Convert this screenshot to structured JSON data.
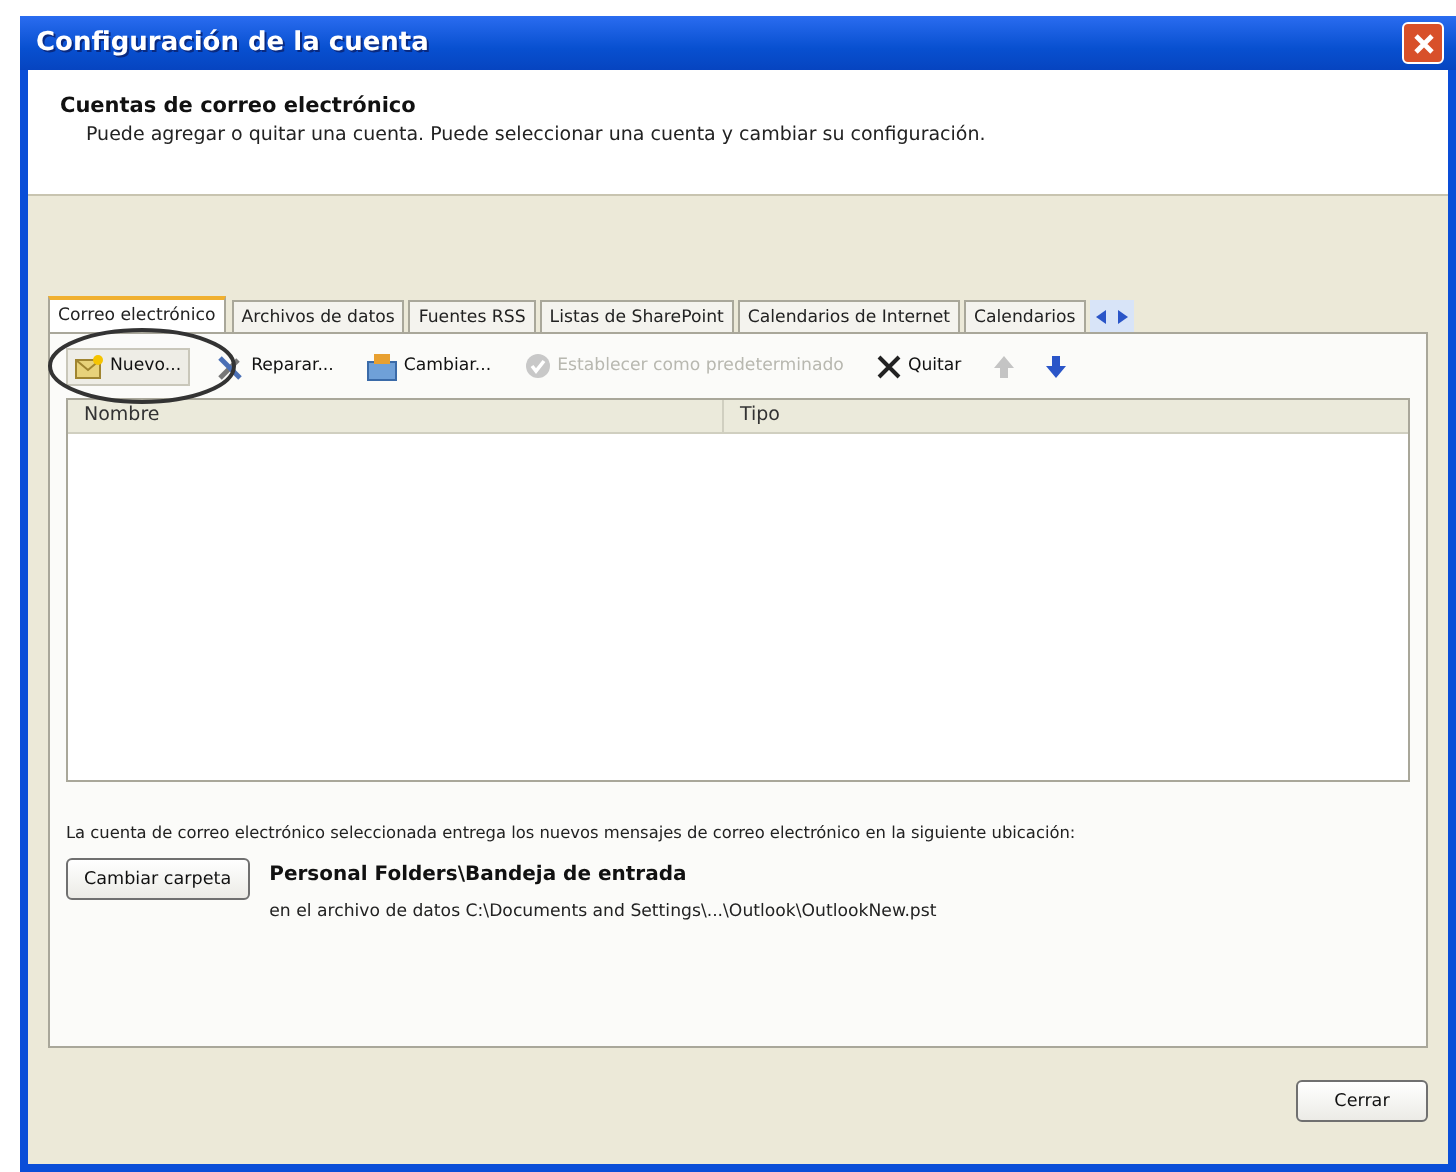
{
  "window": {
    "title": "Configuración de la cuenta"
  },
  "header": {
    "title": "Cuentas de correo electrónico",
    "subtitle": "Puede agregar o quitar una cuenta. Puede seleccionar una cuenta y cambiar su configuración."
  },
  "tabs": [
    {
      "label": "Correo electrónico",
      "selected": true
    },
    {
      "label": "Archivos de datos",
      "selected": false
    },
    {
      "label": "Fuentes RSS",
      "selected": false
    },
    {
      "label": "Listas de SharePoint",
      "selected": false
    },
    {
      "label": "Calendarios de Internet",
      "selected": false
    },
    {
      "label": "Calendarios",
      "selected": false
    }
  ],
  "toolbar": [
    {
      "kind": "new",
      "label": "Nuevo...",
      "disabled": false
    },
    {
      "kind": "repair",
      "label": "Reparar...",
      "disabled": false
    },
    {
      "kind": "change",
      "label": "Cambiar...",
      "disabled": false
    },
    {
      "kind": "default",
      "label": "Establecer como predeterminado",
      "disabled": true
    },
    {
      "kind": "remove",
      "label": "Quitar",
      "disabled": false
    },
    {
      "kind": "up",
      "disabled": true
    },
    {
      "kind": "down",
      "disabled": false
    }
  ],
  "table": {
    "columns": [
      "Nombre",
      "Tipo"
    ]
  },
  "delivery": {
    "text": "La cuenta de correo electrónico seleccionada entrega los nuevos mensajes de correo electrónico en la siguiente ubicación:",
    "button": "Cambiar carpeta",
    "folder": "Personal Folders\\Bandeja de entrada",
    "path": "en el archivo de datos C:\\Documents and Settings\\...\\Outlook\\OutlookNew.pst"
  },
  "buttons": [
    "Cerrar"
  ]
}
